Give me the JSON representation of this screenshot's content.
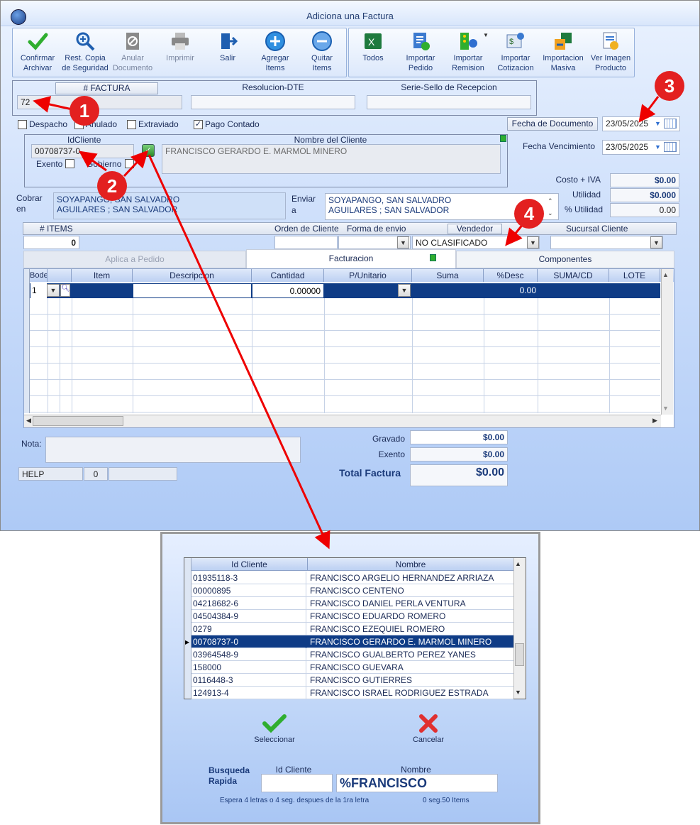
{
  "window": {
    "title": "Adiciona una Factura"
  },
  "toolbar": {
    "group1": [
      {
        "id": "confirmar",
        "label1": "Confirmar",
        "label2": "Archivar",
        "icon": "check-icon"
      },
      {
        "id": "rest",
        "label1": "Rest. Copia",
        "label2": "de Seguridad",
        "icon": "zoom-icon"
      },
      {
        "id": "anular",
        "label1": "Anular",
        "label2": "Documento",
        "icon": "cancel-doc-icon"
      },
      {
        "id": "imprimir",
        "label1": "Imprimir",
        "label2": "",
        "icon": "printer-icon"
      },
      {
        "id": "salir",
        "label1": "Salir",
        "label2": "",
        "icon": "exit-icon"
      },
      {
        "id": "agregar",
        "label1": "Agregar",
        "label2": "Items",
        "icon": "plus-icon"
      },
      {
        "id": "quitar",
        "label1": "Quitar",
        "label2": "Items",
        "icon": "minus-icon"
      }
    ],
    "group2": [
      {
        "id": "todos",
        "label1": "Todos",
        "label2": "",
        "icon": "excel-icon"
      },
      {
        "id": "pedido",
        "label1": "Importar",
        "label2": "Pedido",
        "icon": "import-order-icon"
      },
      {
        "id": "remision",
        "label1": "Importar",
        "label2": "Remision",
        "icon": "import-remision-icon"
      },
      {
        "id": "cotizacion",
        "label1": "Importar",
        "label2": "Cotizacion",
        "icon": "import-quote-icon"
      },
      {
        "id": "masiva",
        "label1": "Importacion",
        "label2": "Masiva",
        "icon": "mass-import-icon"
      },
      {
        "id": "imagen",
        "label1": "Ver Imagen",
        "label2": "Producto",
        "icon": "product-image-icon"
      }
    ]
  },
  "header": {
    "factura_label": "# FACTURA",
    "factura_value": "72",
    "resolucion_label": "Resolucion-DTE",
    "resolucion_value": "",
    "serie_label": "Serie-Sello de Recepcion",
    "serie_value": ""
  },
  "flags": {
    "despacho": "Despacho",
    "anulado": "Anulado",
    "extraviado": "Extraviado",
    "pago_contado": "Pago Contado",
    "pago_contado_checked": true
  },
  "fechas": {
    "doc_label": "Fecha de Documento",
    "doc_value": "23/05/2025",
    "venc_label": "Fecha Vencimiento",
    "venc_value": "23/05/2025"
  },
  "cliente": {
    "id_label": "IdCliente",
    "id_value": "00708737-0",
    "nombre_label": "Nombre del Cliente",
    "nombre_value": "FRANCISCO GERARDO E. MARMOL MINERO",
    "exento": "Exento",
    "gobierno": "Gobierno"
  },
  "totals_side": {
    "costo_label": "Costo + IVA",
    "costo_value": "$0.00",
    "utilidad_label": "Utilidad",
    "utilidad_value": "$0.000",
    "putil_label": "% Utilidad",
    "putil_value": "0.00"
  },
  "cobrar": {
    "label1": "Cobrar",
    "label2": "en",
    "line1": "SOYAPANGO, SAN SALVADRO",
    "line2": "AGUILARES ; SAN SALVADOR"
  },
  "enviar": {
    "label1": "Enviar",
    "label2": "a",
    "line1": "SOYAPANGO, SAN SALVADRO",
    "line2": "AGUILARES ; SAN SALVADOR"
  },
  "info": {
    "items_label": "# ITEMS",
    "items_value": "0",
    "orden_label": "Orden de Cliente",
    "forma_label": "Forma de envio",
    "vendedor_label": "Vendedor",
    "vendedor_value": "NO CLASIFICADO",
    "sucursal_label": "Sucursal Cliente"
  },
  "tabs": {
    "t1": "Aplica a Pedido",
    "t2": "Facturacion",
    "t3": "Componentes"
  },
  "grid": {
    "columns": [
      "Bodega",
      "Item",
      "Descripcion",
      "Cantidad",
      "P/Unitario",
      "Suma",
      "%Desc",
      "SUMA/CD",
      "LOTE"
    ],
    "row1": {
      "bodega": "1",
      "cantidad": "0.00000",
      "desc": "0.00"
    }
  },
  "footer": {
    "nota_label": "Nota:",
    "gravado_label": "Gravado",
    "gravado_value": "$0.00",
    "exento_label": "Exento",
    "exento_value": "$0.00",
    "total_label": "Total Factura",
    "total_value": "$0.00",
    "help": "HELP",
    "help_count": "0"
  },
  "annotations": [
    "1",
    "2",
    "3",
    "4"
  ],
  "dialog": {
    "col_id": "Id Cliente",
    "col_nombre": "Nombre",
    "rows": [
      {
        "id": "01935118-3",
        "nombre": "FRANCISCO ARGELIO HERNANDEZ ARRIAZA"
      },
      {
        "id": "00000895",
        "nombre": "FRANCISCO CENTENO"
      },
      {
        "id": "04218682-6",
        "nombre": "FRANCISCO DANIEL PERLA VENTURA"
      },
      {
        "id": "04504384-9",
        "nombre": "FRANCISCO EDUARDO ROMERO"
      },
      {
        "id": "0279",
        "nombre": "FRANCISCO EZEQUIEL ROMERO"
      },
      {
        "id": "00708737-0",
        "nombre": "FRANCISCO GERARDO E. MARMOL MINERO"
      },
      {
        "id": "03964548-9",
        "nombre": "FRANCISCO GUALBERTO PEREZ YANES"
      },
      {
        "id": "158000",
        "nombre": "FRANCISCO GUEVARA"
      },
      {
        "id": "0116448-3",
        "nombre": "FRANCISCO GUTIERRES"
      },
      {
        "id": "124913-4",
        "nombre": "FRANCISCO ISRAEL RODRIGUEZ ESTRADA"
      }
    ],
    "selected_index": 5,
    "seleccionar": "Seleccionar",
    "cancelar": "Cancelar",
    "busqueda1": "Busqueda",
    "busqueda2": "Rapida",
    "search_id_label": "Id Cliente",
    "search_nombre_label": "Nombre",
    "search_id_value": "",
    "search_nombre_value": "%FRANCISCO",
    "hint": "Espera 4 letras o 4 seg. despues de la 1ra letra",
    "stats": "0 seg.50 Items"
  }
}
